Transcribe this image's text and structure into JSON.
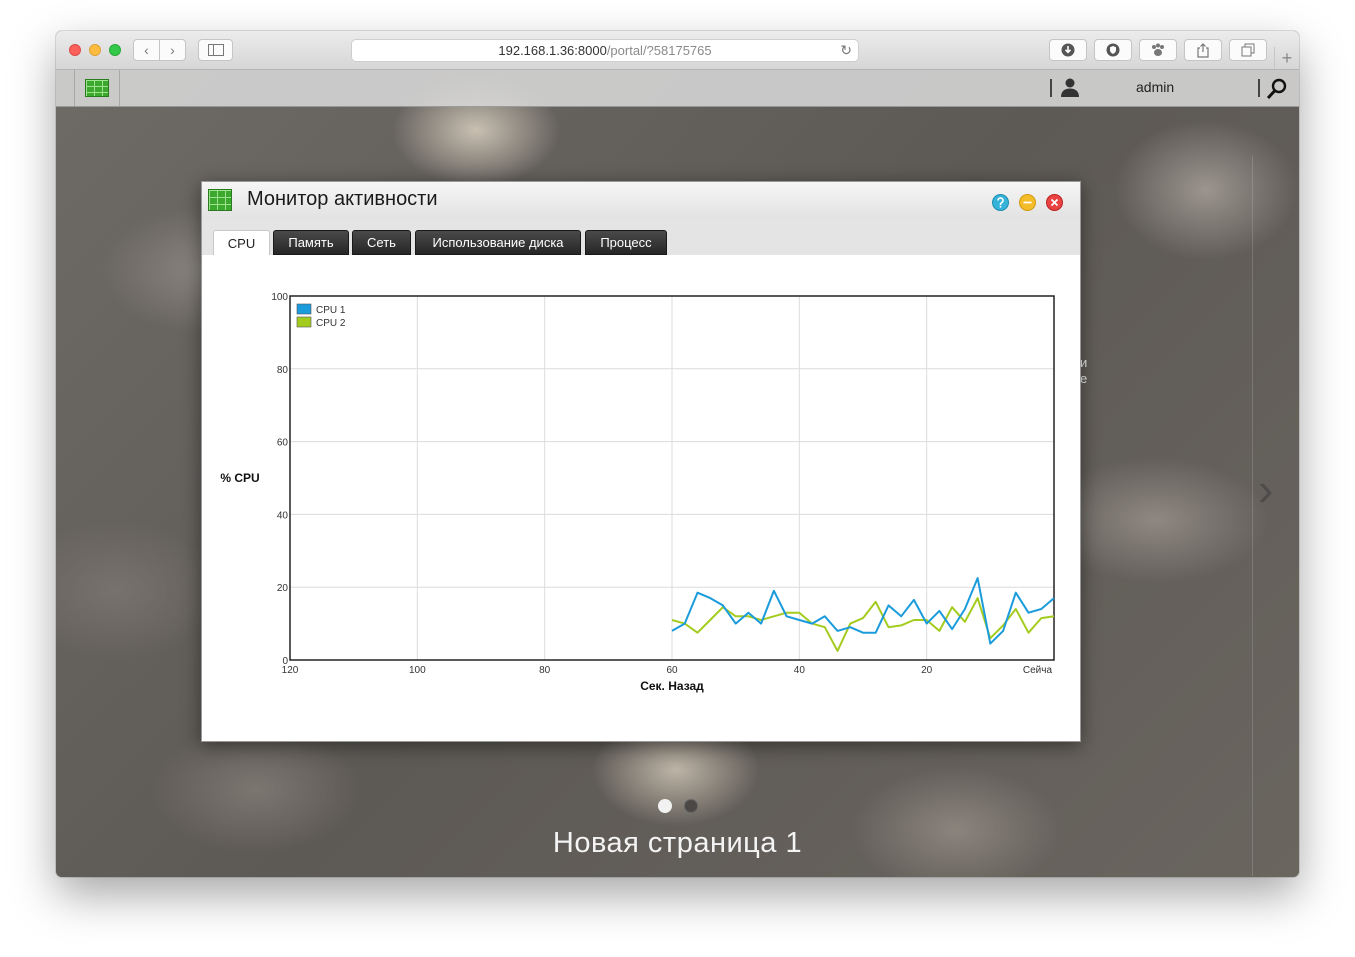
{
  "browser": {
    "address_host": "192.168.1.36:8000",
    "address_path": "/portal/?58175765"
  },
  "appbar": {
    "username": "admin"
  },
  "dialog": {
    "title": "Монитор активности",
    "tabs": [
      "CPU",
      "Память",
      "Сеть",
      "Использование диска",
      "Процесс"
    ],
    "active_tab": 0
  },
  "desktop": {
    "page_name": "Новая страница 1",
    "peek_text": [
      "и",
      "е"
    ]
  },
  "colors": {
    "cpu1": "#1a9bdc",
    "cpu2": "#a4cc1e"
  },
  "chart_data": {
    "type": "line",
    "xlabel": "Сек. Назад",
    "ylabel": "% CPU",
    "xlim": [
      120,
      0
    ],
    "ylim": [
      0,
      100
    ],
    "x_ticks": [
      "120",
      "100",
      "80",
      "60",
      "40",
      "20",
      "Сейча"
    ],
    "y_ticks": [
      "0",
      "20",
      "40",
      "60",
      "80",
      "100"
    ],
    "grid": true,
    "legend_position": "top-left",
    "x": [
      60,
      58,
      56,
      54,
      52,
      50,
      48,
      46,
      44,
      42,
      40,
      38,
      36,
      34,
      32,
      30,
      28,
      26,
      24,
      22,
      20,
      18,
      16,
      14,
      12,
      10,
      8,
      6,
      4,
      2,
      0
    ],
    "series": [
      {
        "name": "CPU 1",
        "values": [
          8,
          10,
          18.5,
          17,
          15,
          10,
          13,
          10,
          19,
          12,
          11,
          10,
          12,
          8,
          9,
          7.5,
          7.5,
          15,
          12,
          16.5,
          10,
          13.5,
          8.5,
          14,
          22.5,
          4.5,
          8,
          18.5,
          13,
          14,
          17
        ]
      },
      {
        "name": "CPU 2",
        "values": [
          11,
          10,
          7.5,
          11,
          14.5,
          12,
          12,
          11,
          12,
          13,
          13,
          10,
          9,
          2.5,
          10,
          11.5,
          16,
          9,
          9.5,
          11,
          11,
          8,
          14.5,
          10.5,
          17,
          6,
          9.5,
          14,
          7.5,
          11.5,
          12
        ]
      }
    ]
  }
}
